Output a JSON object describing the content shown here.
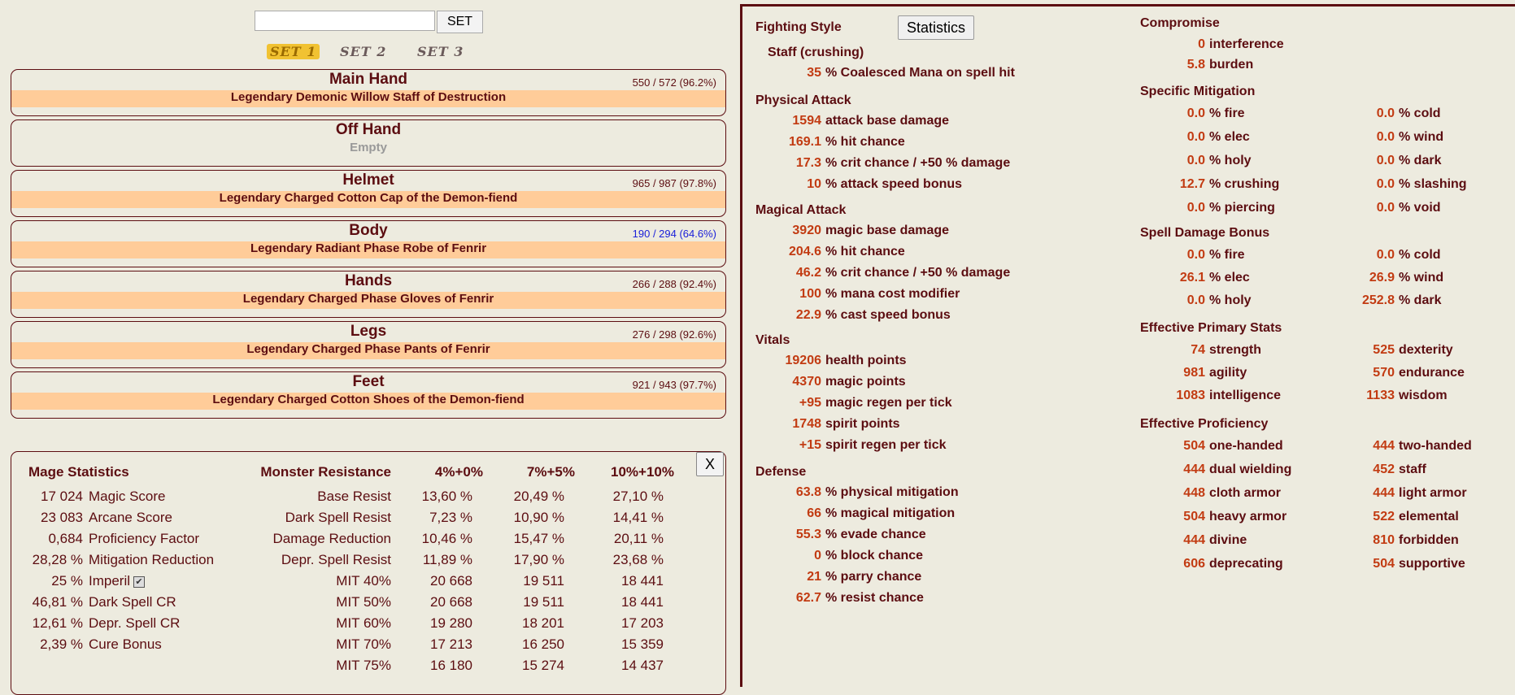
{
  "set_bar": {
    "input_value": "",
    "button_label": "SET",
    "tabs": [
      "SET 1",
      "SET 2",
      "SET 3"
    ]
  },
  "slots": [
    {
      "name": "Main Hand",
      "condition": "550 / 572 (96.2%)",
      "item": "Legendary Demonic Willow Staff of Destruction"
    },
    {
      "name": "Off Hand",
      "condition": "",
      "item": "Empty"
    },
    {
      "name": "Helmet",
      "condition": "965 / 987 (97.8%)",
      "item": "Legendary Charged Cotton Cap of the Demon-fiend"
    },
    {
      "name": "Body",
      "condition": "190 / 294 (64.6%)",
      "item": "Legendary Radiant Phase Robe of Fenrir"
    },
    {
      "name": "Hands",
      "condition": "266 / 288 (92.4%)",
      "item": "Legendary Charged Phase Gloves of Fenrir"
    },
    {
      "name": "Legs",
      "condition": "276 / 298 (92.6%)",
      "item": "Legendary Charged Phase Pants of Fenrir"
    },
    {
      "name": "Feet",
      "condition": "921 / 943 (97.7%)",
      "item": "Legendary Charged Cotton Shoes of the Demon-fiend"
    }
  ],
  "mage": {
    "title": "Mage Statistics",
    "close_label": "X",
    "rows": [
      {
        "value": "17 024",
        "label": "Magic Score"
      },
      {
        "value": "23 083",
        "label": "Arcane Score"
      },
      {
        "value": "0,684",
        "label": "Proficiency Factor"
      },
      {
        "value": "28,28 %",
        "label": "Mitigation Reduction"
      },
      {
        "value": "25 %",
        "label": "Imperil"
      },
      {
        "value": "46,81 %",
        "label": "Dark Spell CR"
      },
      {
        "value": "12,61 %",
        "label": "Depr. Spell CR"
      },
      {
        "value": "2,39 %",
        "label": "Cure Bonus"
      }
    ],
    "imperil_check": "✔",
    "resist": {
      "headers": [
        "Monster Resistance",
        "4%+0%",
        "7%+5%",
        "10%+10%"
      ],
      "rows": [
        [
          "Base Resist",
          "13,60 %",
          "20,49 %",
          "27,10 %"
        ],
        [
          "Dark Spell Resist",
          "7,23 %",
          "10,90 %",
          "14,41 %"
        ],
        [
          "Damage Reduction",
          "10,46 %",
          "15,47 %",
          "20,11 %"
        ],
        [
          "Depr. Spell Resist",
          "11,89 %",
          "17,90 %",
          "23,68 %"
        ],
        [
          "MIT 40%",
          "20 668",
          "19 511",
          "18 441"
        ],
        [
          "MIT 50%",
          "20 668",
          "19 511",
          "18 441"
        ],
        [
          "MIT 60%",
          "19 280",
          "18 201",
          "17 203"
        ],
        [
          "MIT 70%",
          "17 213",
          "16 250",
          "15 359"
        ],
        [
          "MIT 75%",
          "16 180",
          "15 274",
          "14 437"
        ]
      ]
    }
  },
  "stats": {
    "fighting_style": "Fighting Style",
    "statistics_button": "Statistics",
    "style_name": "Staff (crushing)",
    "style_val": "35",
    "style_label": "% Coalesced Mana on spell hit",
    "physical": {
      "title": "Physical Attack",
      "rows": [
        {
          "v": "1594",
          "l": "attack base damage"
        },
        {
          "v": "169.1",
          "l": "% hit chance"
        },
        {
          "v": "17.3",
          "l": "% crit chance / +50 % damage"
        },
        {
          "v": "10",
          "l": "% attack speed bonus"
        }
      ]
    },
    "magical": {
      "title": "Magical Attack",
      "rows": [
        {
          "v": "3920",
          "l": "magic base damage"
        },
        {
          "v": "204.6",
          "l": "% hit chance"
        },
        {
          "v": "46.2",
          "l": "% crit chance / +50 % damage"
        },
        {
          "v": "100",
          "l": "% mana cost modifier"
        },
        {
          "v": "22.9",
          "l": "% cast speed bonus"
        }
      ]
    },
    "vitals": {
      "title": "Vitals",
      "rows": [
        {
          "v": "19206",
          "l": "health points"
        },
        {
          "v": "4370",
          "l": "magic points"
        },
        {
          "v": "+95",
          "l": "magic regen per tick"
        },
        {
          "v": "1748",
          "l": "spirit points"
        },
        {
          "v": "+15",
          "l": "spirit regen per tick"
        }
      ]
    },
    "defense": {
      "title": "Defense",
      "rows": [
        {
          "v": "63.8",
          "l": "% physical mitigation"
        },
        {
          "v": "66",
          "l": "% magical mitigation"
        },
        {
          "v": "55.3",
          "l": "% evade chance"
        },
        {
          "v": "0",
          "l": "% block chance"
        },
        {
          "v": "21",
          "l": "% parry chance"
        },
        {
          "v": "62.7",
          "l": "% resist chance"
        }
      ]
    },
    "compromise": {
      "title": "Compromise",
      "rows": [
        {
          "v": "0",
          "l": "interference"
        },
        {
          "v": "5.8",
          "l": "burden"
        }
      ]
    },
    "specific": {
      "title": "Specific Mitigation",
      "rows": [
        {
          "v1": "0.0",
          "l1": "% fire",
          "v2": "0.0",
          "l2": "% cold"
        },
        {
          "v1": "0.0",
          "l1": "% elec",
          "v2": "0.0",
          "l2": "% wind"
        },
        {
          "v1": "0.0",
          "l1": "% holy",
          "v2": "0.0",
          "l2": "% dark"
        },
        {
          "v1": "12.7",
          "l1": "% crushing",
          "v2": "0.0",
          "l2": "% slashing"
        },
        {
          "v1": "0.0",
          "l1": "% piercing",
          "v2": "0.0",
          "l2": "% void"
        }
      ]
    },
    "spell_bonus": {
      "title": "Spell Damage Bonus",
      "rows": [
        {
          "v1": "0.0",
          "l1": "% fire",
          "v2": "0.0",
          "l2": "% cold"
        },
        {
          "v1": "26.1",
          "l1": "% elec",
          "v2": "26.9",
          "l2": "% wind"
        },
        {
          "v1": "0.0",
          "l1": "% holy",
          "v2": "252.8",
          "l2": "% dark"
        }
      ]
    },
    "primary": {
      "title": "Effective Primary Stats",
      "rows": [
        {
          "v1": "74",
          "l1": "strength",
          "v2": "525",
          "l2": "dexterity"
        },
        {
          "v1": "981",
          "l1": "agility",
          "v2": "570",
          "l2": "endurance"
        },
        {
          "v1": "1083",
          "l1": "intelligence",
          "v2": "1133",
          "l2": "wisdom"
        }
      ]
    },
    "proficiency": {
      "title": "Effective Proficiency",
      "rows": [
        {
          "v1": "504",
          "l1": "one-handed",
          "v2": "444",
          "l2": "two-handed"
        },
        {
          "v1": "444",
          "l1": "dual wielding",
          "v2": "452",
          "l2": "staff"
        },
        {
          "v1": "448",
          "l1": "cloth armor",
          "v2": "444",
          "l2": "light armor"
        },
        {
          "v1": "504",
          "l1": "heavy armor",
          "v2": "522",
          "l2": "elemental"
        },
        {
          "v1": "444",
          "l1": "divine",
          "v2": "810",
          "l2": "forbidden"
        },
        {
          "v1": "606",
          "l1": "deprecating",
          "v2": "504",
          "l2": "supportive"
        }
      ]
    }
  }
}
